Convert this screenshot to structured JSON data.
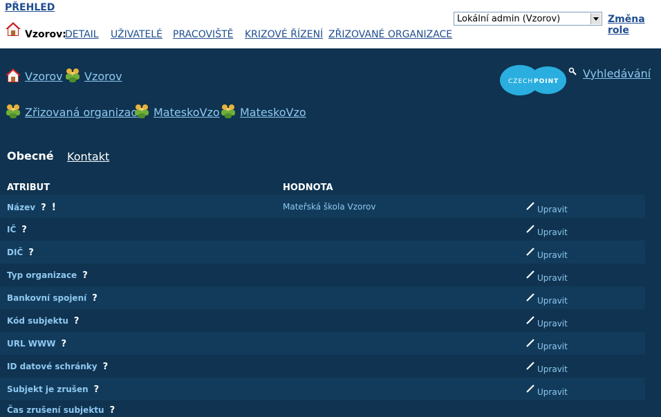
{
  "header": {
    "overview_label": "PŘEHLED",
    "context_label": "Vzorov:",
    "nav": [
      "DETAIL",
      "UŽIVATELÉ",
      "PRACOVIŠTĚ",
      "KRIZOVÉ ŘÍZENÍ",
      "ZŘIZOVANÉ ORGANIZACE"
    ],
    "role_value": "Lokální admin (Vzorov)",
    "change_role_label": "Změna role"
  },
  "breadcrumbs": {
    "row1": [
      "Vzorov",
      "Vzorov"
    ],
    "row2": [
      "Zřizovaná organizace",
      "MateskoVzo",
      "MateskoVzo"
    ]
  },
  "logo_text": {
    "part1": "CZECH",
    "part2": "POINT"
  },
  "search_label": "Vyhledávání",
  "tabs": {
    "general": "Obecné",
    "contact": "Kontakt"
  },
  "table": {
    "headers": {
      "attribute": "ATRIBUT",
      "value": "HODNOTA"
    },
    "edit_label": "Upravit",
    "help_mark": "?",
    "required_mark": "!",
    "rows": [
      {
        "name": "Název",
        "value": "Mateřská škola Vzorov"
      },
      {
        "name": "IČ",
        "value": ""
      },
      {
        "name": "DIČ",
        "value": ""
      },
      {
        "name": "Typ organizace",
        "value": ""
      },
      {
        "name": "Bankovní spojení",
        "value": ""
      },
      {
        "name": "Kód subjektu",
        "value": ""
      },
      {
        "name": "URL WWW",
        "value": ""
      },
      {
        "name": "ID datové schránky",
        "value": ""
      },
      {
        "name": "Subjekt je zrušen",
        "value": ""
      },
      {
        "name": "Čas zrušení subjektu",
        "value": ""
      }
    ]
  },
  "colors": {
    "background": "#0f3350",
    "link": "#8fc8f0",
    "nav_link": "#1f4d8f",
    "logo": "#2aaee0"
  }
}
